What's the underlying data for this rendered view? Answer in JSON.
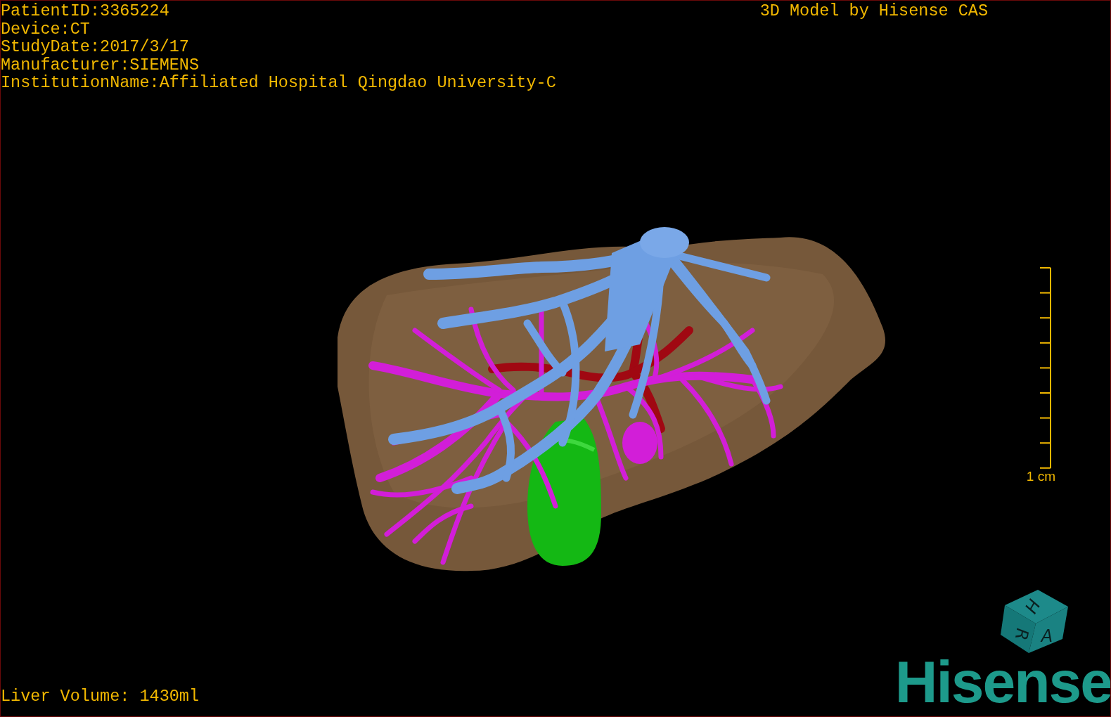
{
  "info_lines": [
    "PatientID:3365224",
    "Device:CT",
    "StudyDate:2017/3/17",
    "Manufacturer:SIEMENS",
    "InstitutionName:Affiliated Hospital Qingdao University-C"
  ],
  "title": "3D Model by Hisense CAS",
  "scale_bar": {
    "label": "1 cm"
  },
  "liver_volume": "Liver Volume: 1430ml",
  "orientation_cube": {
    "labels": [
      "H",
      "R",
      "A"
    ]
  },
  "logo": "Hisense"
}
